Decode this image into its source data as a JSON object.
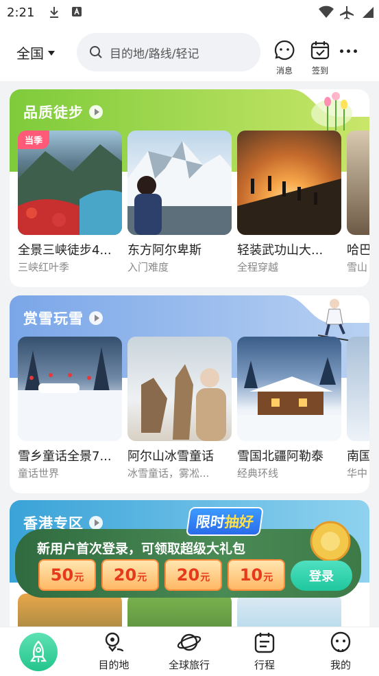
{
  "status": {
    "time": "2:21"
  },
  "header": {
    "region": "全国",
    "search_placeholder": "目的地/路线/轻记",
    "message_label": "消息",
    "checkin_label": "签到"
  },
  "sections": [
    {
      "title": "品质徒步",
      "items": [
        {
          "badge": "当季",
          "name": "全景三峡徒步4...",
          "sub": "三峡红叶季"
        },
        {
          "name": "东方阿尔卑斯",
          "sub": "入门难度"
        },
        {
          "name": "轻装武功山大...",
          "sub": "全程穿越"
        },
        {
          "name": "哈巴",
          "sub": "雪山"
        }
      ]
    },
    {
      "title": "赏雪玩雪",
      "items": [
        {
          "name": "雪乡童话全景7...",
          "sub": "童话世界"
        },
        {
          "name": "阿尔山冰雪童话",
          "sub": "冰雪童话，雾凇..."
        },
        {
          "name": "雪国北疆阿勒泰",
          "sub": "经典环线"
        },
        {
          "name": "南国",
          "sub": "华中"
        }
      ]
    },
    {
      "title": "香港专区"
    }
  ],
  "promo": {
    "badge_a": "限时",
    "badge_b": "抽好",
    "text": "新用户首次登录，可领取超级大礼包",
    "coupons": [
      {
        "amount": "50",
        "unit": "元"
      },
      {
        "amount": "20",
        "unit": "元"
      },
      {
        "amount": "20",
        "unit": "元"
      },
      {
        "amount": "10",
        "unit": "元"
      }
    ],
    "login": "登录"
  },
  "nav": {
    "destination": "目的地",
    "global": "全球旅行",
    "trip": "行程",
    "mine": "我的"
  }
}
